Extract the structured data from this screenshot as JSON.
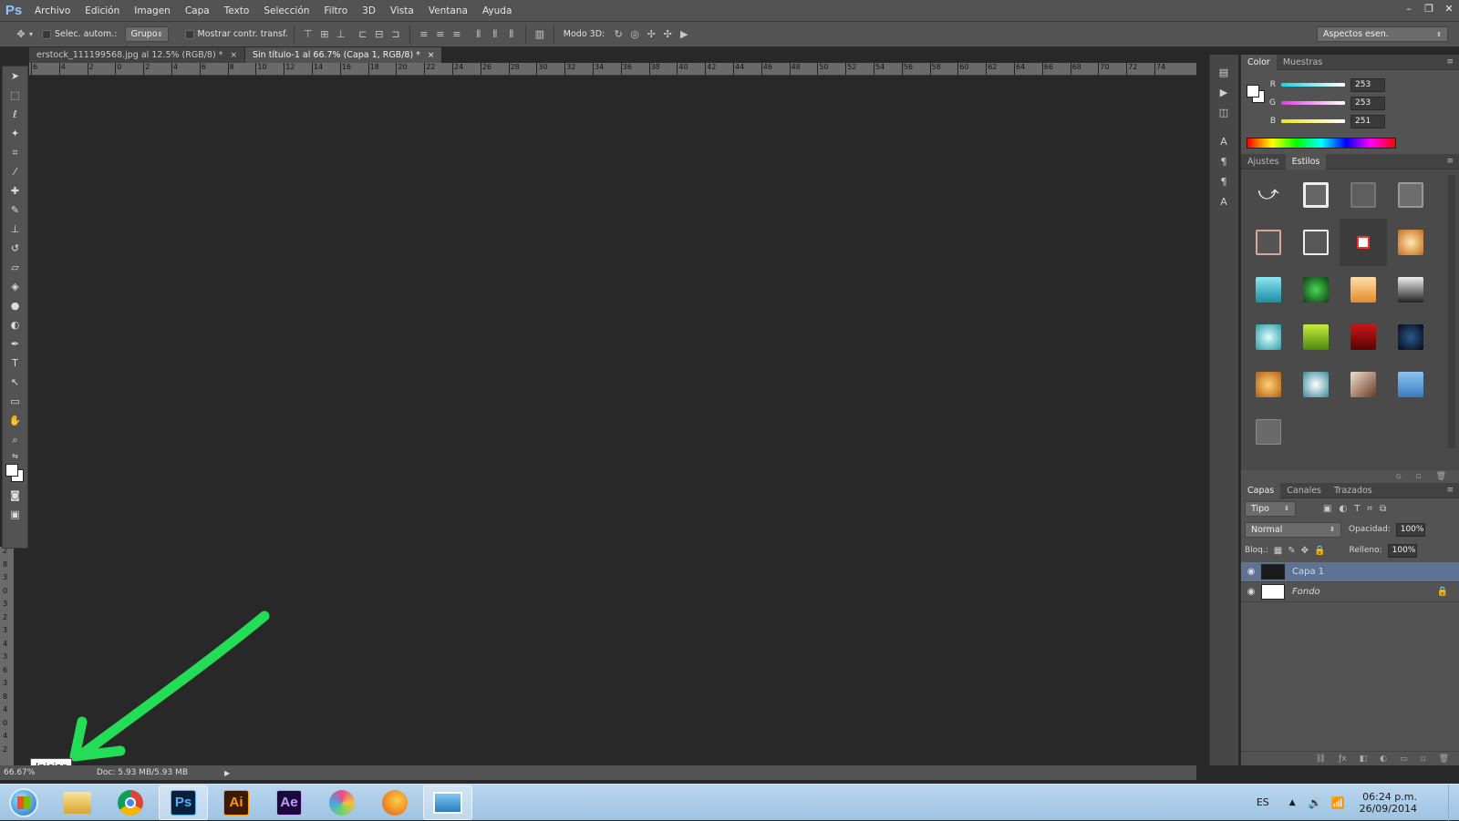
{
  "app": {
    "logo": "Ps"
  },
  "menu": [
    "Archivo",
    "Edición",
    "Imagen",
    "Capa",
    "Texto",
    "Selección",
    "Filtro",
    "3D",
    "Vista",
    "Ventana",
    "Ayuda"
  ],
  "window_controls": [
    "–",
    "❐",
    "✕"
  ],
  "options": {
    "auto_select_label": "Selec. autom.:",
    "auto_select_value": "Grupo",
    "show_transform_label": "Mostrar contr. transf.",
    "mode3d_label": "Modo 3D:",
    "workspace": "Aspectos esen."
  },
  "tabs": [
    {
      "title": "erstock_111199568.jpg al 12.5% (RGB/8) *",
      "close": "×"
    },
    {
      "title": "Sin título-1 al 66.7% (Capa 1, RGB/8) *",
      "close": "×"
    }
  ],
  "ruler": {
    "top_labels": [
      "6",
      "4",
      "2",
      "0",
      "2",
      "4",
      "6",
      "8",
      "10",
      "12",
      "14",
      "16",
      "18",
      "20",
      "22",
      "24",
      "26",
      "28",
      "30",
      "32",
      "34",
      "36",
      "38",
      "40",
      "42",
      "44",
      "46",
      "48",
      "50",
      "52",
      "54",
      "56",
      "58",
      "60",
      "62",
      "64",
      "66",
      "68",
      "70",
      "72",
      "74"
    ],
    "left_labels": [
      "2",
      "8",
      "3",
      "0",
      "3",
      "2",
      "3",
      "4",
      "3",
      "6",
      "3",
      "8",
      "4",
      "0",
      "4",
      "2"
    ]
  },
  "status": {
    "zoom": "66.67%",
    "doc": "Doc: 5.93 MB/5.93 MB",
    "arrow": "▶"
  },
  "tooltip": "Iniciar",
  "color_panel": {
    "tabs": [
      "Color",
      "Muestras"
    ],
    "channels": [
      {
        "label": "R",
        "value": "253",
        "color": "#11d6e6"
      },
      {
        "label": "G",
        "value": "253",
        "color": "#e23ce0"
      },
      {
        "label": "B",
        "value": "251",
        "color": "#e8e61a"
      }
    ]
  },
  "styles_panel": {
    "tabs": [
      "Ajustes",
      "Estilos"
    ]
  },
  "layers_panel": {
    "tabs": [
      "Capas",
      "Canales",
      "Trazados"
    ],
    "filter": "Tipo",
    "blend": "Normal",
    "opacity_label": "Opacidad:",
    "opacity": "100%",
    "lock_label": "Bloq.:",
    "fill_label": "Relleno:",
    "fill": "100%",
    "layers": [
      {
        "name": "Capa 1",
        "selected": true
      },
      {
        "name": "Fondo",
        "selected": false
      }
    ]
  },
  "taskbar": {
    "apps": [
      "Explorador",
      "Chrome",
      "Ps",
      "Ai",
      "Ae",
      "Paint",
      "Firefox",
      "Fotos"
    ],
    "lang": "ES",
    "time": "06:24 p.m.",
    "date": "26/09/2014"
  }
}
